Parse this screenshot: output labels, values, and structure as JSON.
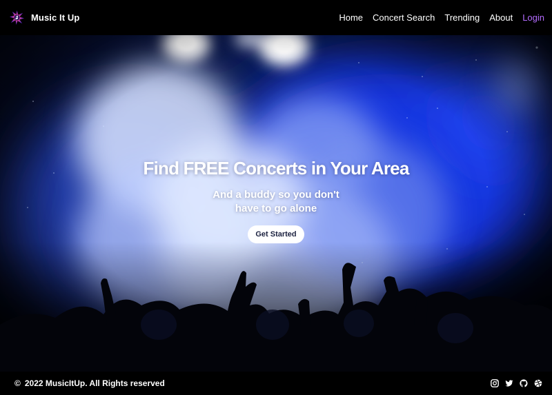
{
  "header": {
    "brand": "Music It Up",
    "nav": [
      {
        "label": "Home"
      },
      {
        "label": "Concert Search"
      },
      {
        "label": "Trending"
      },
      {
        "label": "About"
      },
      {
        "label": "Login"
      }
    ]
  },
  "hero": {
    "title": "Find FREE Concerts in Your Area",
    "subtitle": "And a buddy so you don't have to go alone",
    "cta": "Get Started"
  },
  "footer": {
    "copyright_symbol": "©",
    "copyright_text": "2022 MusicItUp. All Rights reserved",
    "socials": [
      "instagram-icon",
      "twitter-icon",
      "github-icon",
      "dribbble-icon"
    ]
  },
  "colors": {
    "accent": "#b46cff",
    "background": "#000000",
    "hero_blue": "#1a3aff",
    "button_text": "#1c2240"
  }
}
